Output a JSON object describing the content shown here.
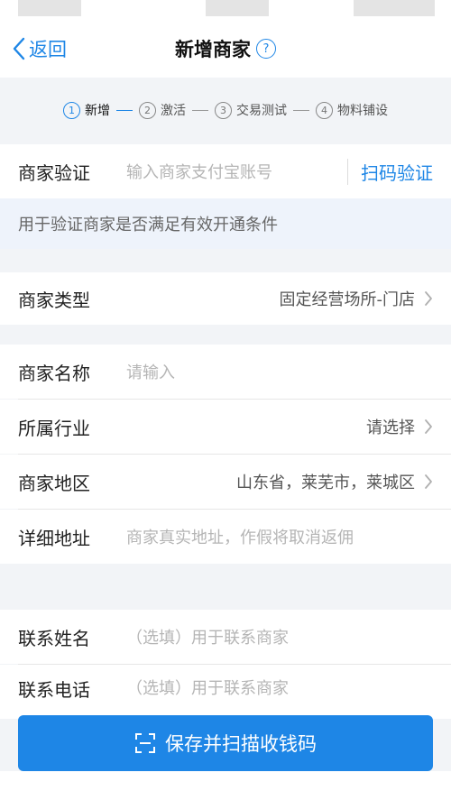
{
  "nav": {
    "back_label": "返回",
    "title": "新增商家",
    "help_glyph": "?"
  },
  "steps": [
    {
      "num": "1",
      "label": "新增"
    },
    {
      "num": "2",
      "label": "激活"
    },
    {
      "num": "3",
      "label": "交易测试"
    },
    {
      "num": "4",
      "label": "物料铺设"
    }
  ],
  "verify": {
    "label": "商家验证",
    "placeholder": "输入商家支付宝账号",
    "scan_label": "扫码验证",
    "hint": "用于验证商家是否满足有效开通条件"
  },
  "merchant_type": {
    "label": "商家类型",
    "value": "固定经营场所-门店"
  },
  "form": {
    "name": {
      "label": "商家名称",
      "placeholder": "请输入"
    },
    "industry": {
      "label": "所属行业",
      "value": "请选择"
    },
    "region": {
      "label": "商家地区",
      "value": "山东省，莱芜市，莱城区"
    },
    "address": {
      "label": "详细地址",
      "placeholder": "商家真实地址，作假将取消返佣"
    }
  },
  "contact": {
    "name": {
      "label": "联系姓名",
      "placeholder": "（选填）用于联系商家"
    },
    "phone": {
      "label": "联系电话",
      "placeholder": "（选填）用于联系商家"
    }
  },
  "save_button": {
    "label": "保存并扫描收钱码"
  },
  "colors": {
    "accent": "#1e86e6",
    "background": "#f2f4f7"
  }
}
